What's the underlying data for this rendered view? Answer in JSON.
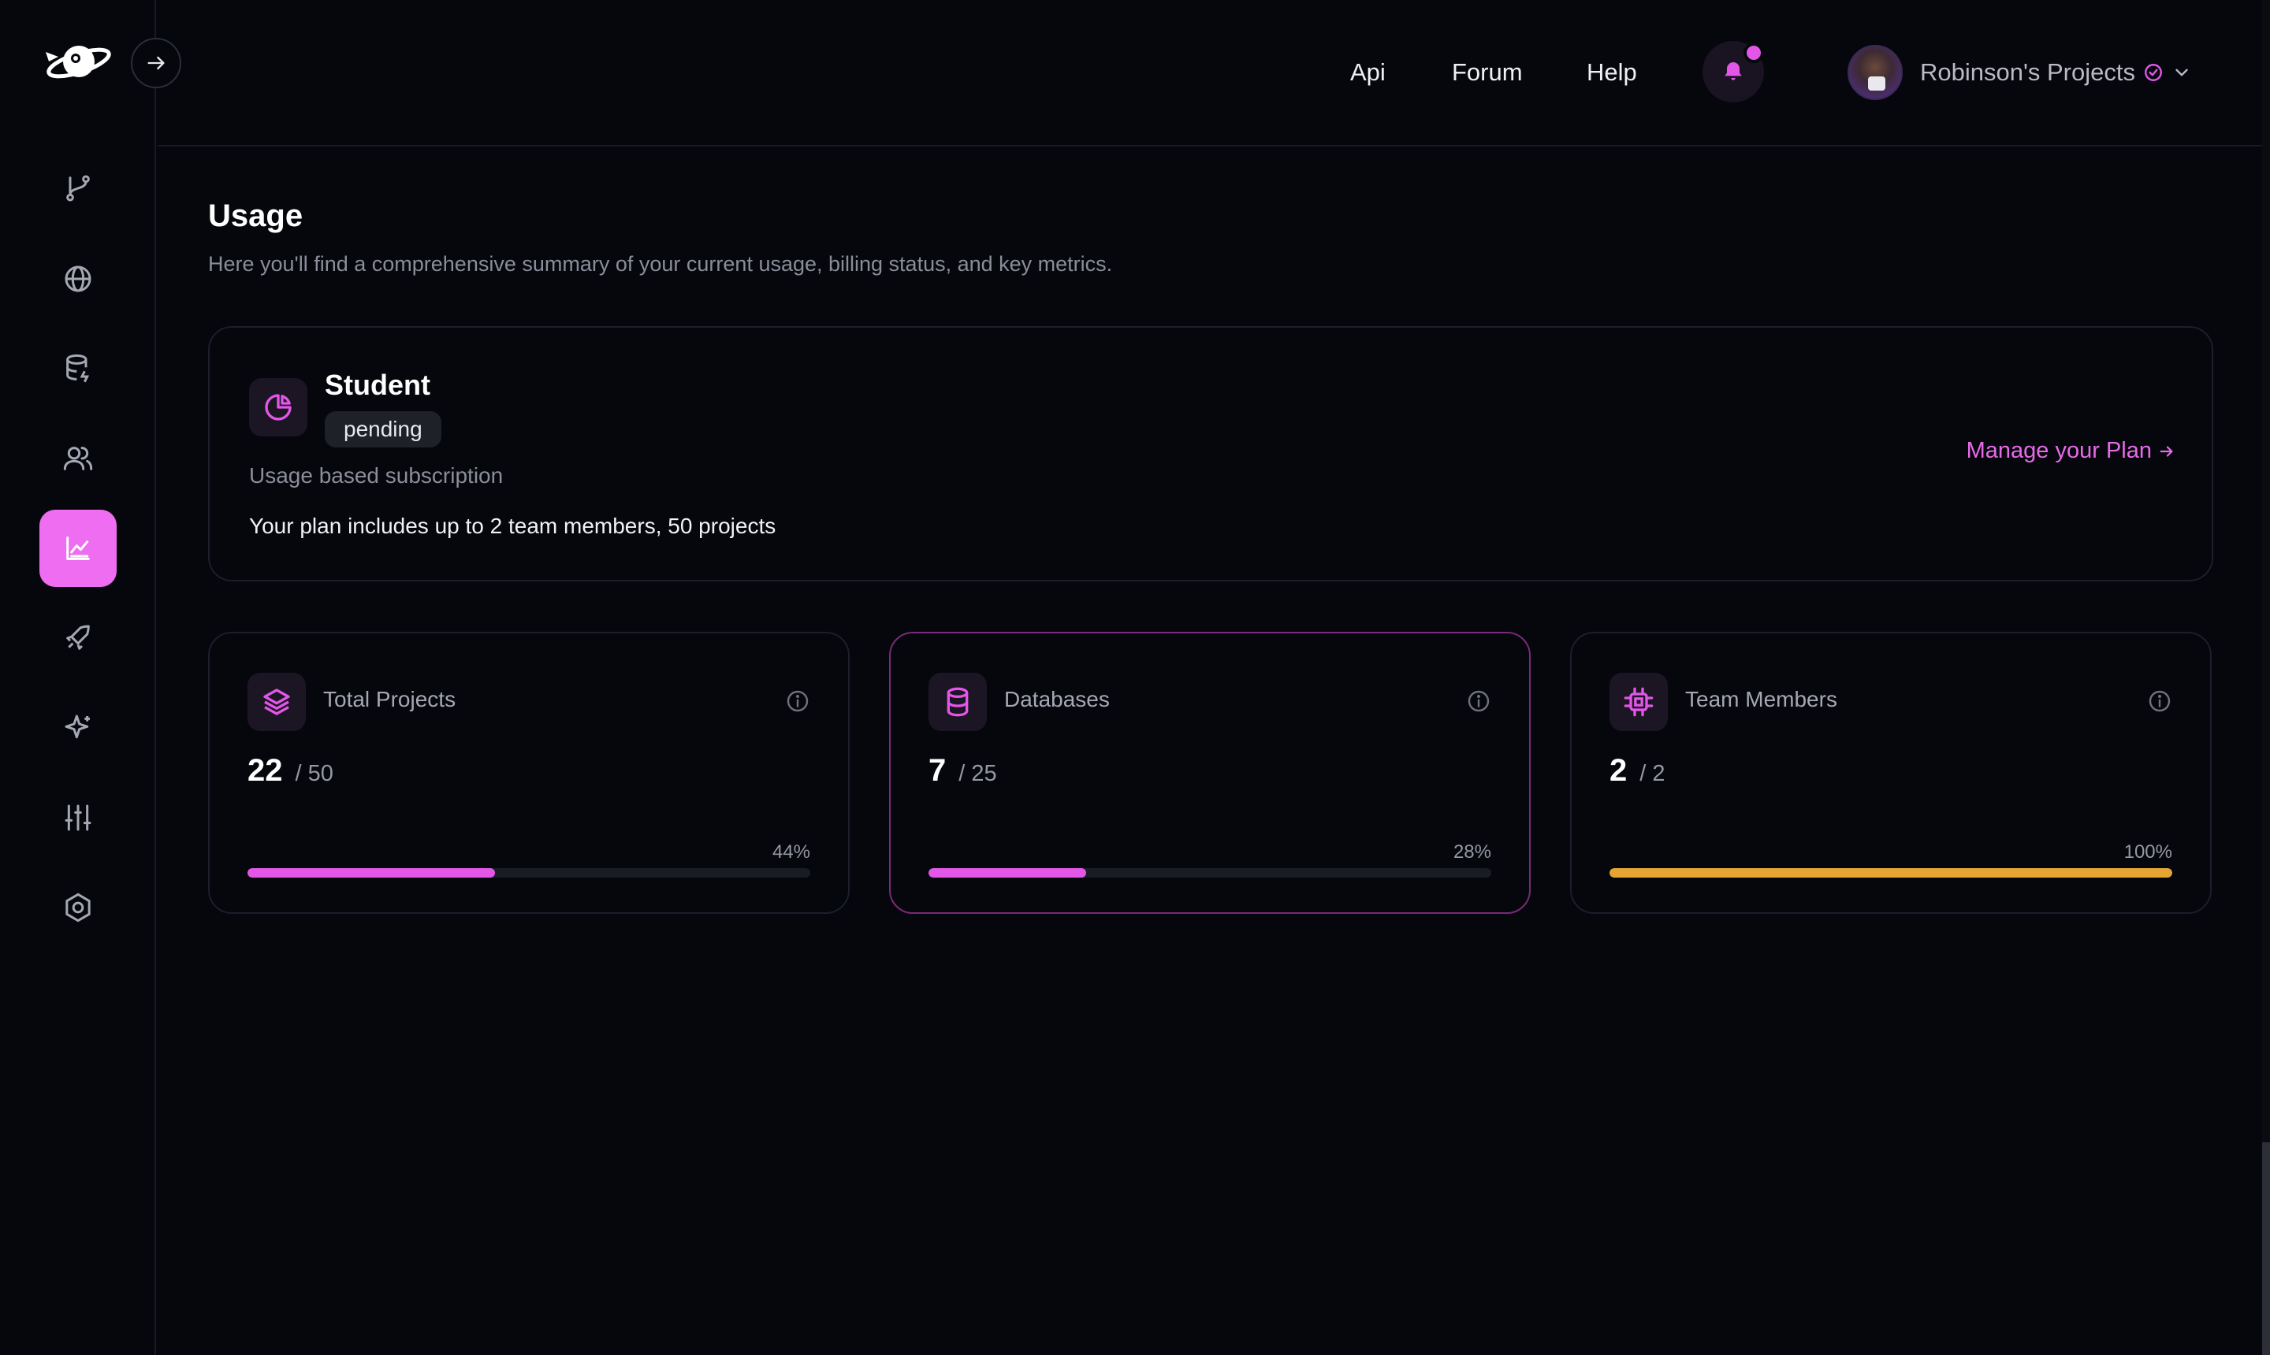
{
  "header": {
    "links": [
      {
        "label": "Api"
      },
      {
        "label": "Forum"
      },
      {
        "label": "Help"
      }
    ],
    "profile_name": "Robinson's Projects"
  },
  "sidebar": {
    "items": [
      {
        "icon": "git-branch-icon"
      },
      {
        "icon": "globe-icon"
      },
      {
        "icon": "database-icon"
      },
      {
        "icon": "users-icon"
      },
      {
        "icon": "chart-icon",
        "active": true
      },
      {
        "icon": "rocket-icon"
      },
      {
        "icon": "sparkle-icon"
      },
      {
        "icon": "sliders-icon"
      },
      {
        "icon": "settings-icon"
      }
    ]
  },
  "page": {
    "title": "Usage",
    "description": "Here you'll find a comprehensive summary of your current usage, billing status, and key metrics."
  },
  "plan": {
    "name": "Student",
    "status": "pending",
    "type": "Usage based subscription",
    "includes": "Your plan includes up to 2 team members, 50 projects",
    "manage_label": "Manage your Plan"
  },
  "metrics": [
    {
      "title": "Total Projects",
      "used": "22",
      "limit": "/ 50",
      "percent_label": "44%",
      "percent": 44,
      "color": "#e356e8",
      "icon": "layers-icon"
    },
    {
      "title": "Databases",
      "used": "7",
      "limit": "/ 25",
      "percent_label": "28%",
      "percent": 28,
      "color": "#e356e8",
      "icon": "database-icon"
    },
    {
      "title": "Team Members",
      "used": "2",
      "limit": "/ 2",
      "percent_label": "100%",
      "percent": 100,
      "color": "#e5a532",
      "icon": "cpu-icon"
    }
  ],
  "colors": {
    "accent": "#ef6df0",
    "background": "#05070d",
    "warning": "#e5a532"
  }
}
